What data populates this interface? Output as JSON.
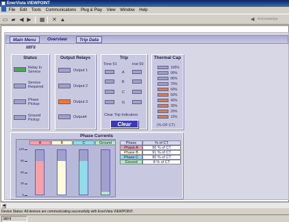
{
  "window": {
    "title": "EnerVista VIEWPOINT"
  },
  "menu": [
    "File",
    "Edit",
    "Tools",
    "Communications",
    "Plug & Play",
    "View",
    "Window",
    "Help"
  ],
  "toolbar": {
    "acknowledge_label": "Acknowledge"
  },
  "nav": {
    "main_menu": "Main Menu",
    "overview": "Overview",
    "trip_data": "Trip Data"
  },
  "device_name": "MIFII",
  "status": {
    "title": "Status",
    "items": [
      {
        "label": "Relay In Service",
        "color": "#40b040"
      },
      {
        "label": "Service Required",
        "color": "#9fa0cc"
      },
      {
        "label": "Phase Pickup",
        "color": "#9fa0cc"
      },
      {
        "label": "Ground Pickup",
        "color": "#9fa0cc"
      }
    ]
  },
  "output_relays": {
    "title": "Output Relays",
    "items": [
      {
        "label": "Output 1",
        "color": "#9fa0cc"
      },
      {
        "label": "Output 2",
        "color": "#9fa0cc"
      },
      {
        "label": "Output 3",
        "color": "#f07830"
      },
      {
        "label": "Output4",
        "color": "#9fa0cc"
      }
    ]
  },
  "trip": {
    "title": "Trip",
    "col1": "Time 51",
    "col2": "Inst 50",
    "rows": [
      "A",
      "B",
      "C",
      "G"
    ],
    "clear_label": "Clear Trip Indicators",
    "clear_button": "Clear"
  },
  "thermal_cap": {
    "title": "Thermal Cap",
    "levels": [
      "100%",
      "90%",
      "80%",
      "70%",
      "60%",
      "50%",
      "40%",
      "30%",
      "20%",
      "10%"
    ],
    "value_percent": 60,
    "footer": "(% OF CT)"
  },
  "phase_currents": {
    "title": "Phase Currents",
    "columns": [
      {
        "name": "A",
        "color": "#f8a0a8",
        "value": 90
      },
      {
        "name": "B",
        "color": "#fffbd8",
        "value": 91
      },
      {
        "name": "C",
        "color": "#90dde8",
        "value": 90
      },
      {
        "name": "Ground",
        "color": "#b8ecc0",
        "value": 8
      }
    ],
    "ticks": [
      "120",
      "90",
      "60",
      "30",
      "0"
    ],
    "table_headers": [
      "Phase",
      "% of CT"
    ],
    "table_rows": [
      {
        "phase": "Phase A",
        "value": "90 % of CT",
        "color": "#f8a0a8"
      },
      {
        "phase": "Phase B",
        "value": "91 % of CT",
        "color": "#fffbd8"
      },
      {
        "phase": "Phase C",
        "value": "90 % of CT",
        "color": "#90dde8"
      },
      {
        "phase": "Ground",
        "value": "8 % of CT",
        "color": "#b8ecc0"
      }
    ]
  },
  "statusbar": {
    "message": "Device Status:  All devices are communicating successfully with EnerVista VIEWPOINT.",
    "field": "MIFII"
  }
}
